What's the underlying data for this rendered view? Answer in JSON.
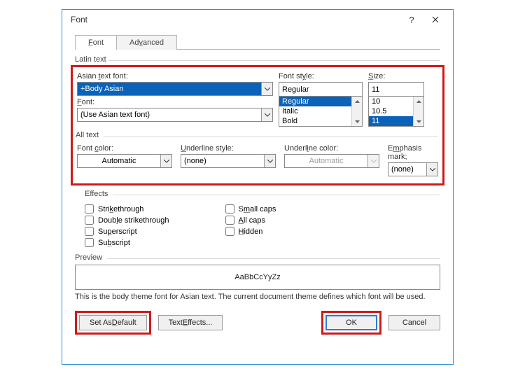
{
  "dialog": {
    "title": "Font"
  },
  "tabs": {
    "font": "Font",
    "advanced": "Advanced"
  },
  "group_labels": {
    "latin": "Latin text",
    "all": "All text",
    "effects": "Effects",
    "preview": "Preview"
  },
  "labels": {
    "asian_font": "Asian text font:",
    "font": "Font:",
    "font_style": "Font style:",
    "size": "Size:",
    "font_color": "Font color:",
    "underline_style": "Underline style:",
    "underline_color": "Underline color:",
    "emphasis_mark": "Emphasis mark;"
  },
  "values": {
    "asian_font": "+Body Asian",
    "font": "(Use Asian text font)",
    "font_style": "Regular",
    "size": "11",
    "font_color": "Automatic",
    "underline_style": "(none)",
    "underline_color": "Automatic",
    "emphasis_mark": "(none)"
  },
  "font_style_options": [
    "Regular",
    "Italic",
    "Bold"
  ],
  "size_options": [
    "10",
    "10.5",
    "11"
  ],
  "effects": {
    "strike": "Strikethrough",
    "dstrike": "Double strikethrough",
    "super": "Superscript",
    "sub": "Subscript",
    "smallcaps": "Small caps",
    "allcaps": "All caps",
    "hidden": "Hidden"
  },
  "preview": {
    "text": "AaBbCcYyZz",
    "note": "This is the body theme font for Asian text. The current document theme defines which font will be used."
  },
  "buttons": {
    "set_default": "Set As Default",
    "text_effects": "Text Effects...",
    "ok": "OK",
    "cancel": "Cancel"
  }
}
